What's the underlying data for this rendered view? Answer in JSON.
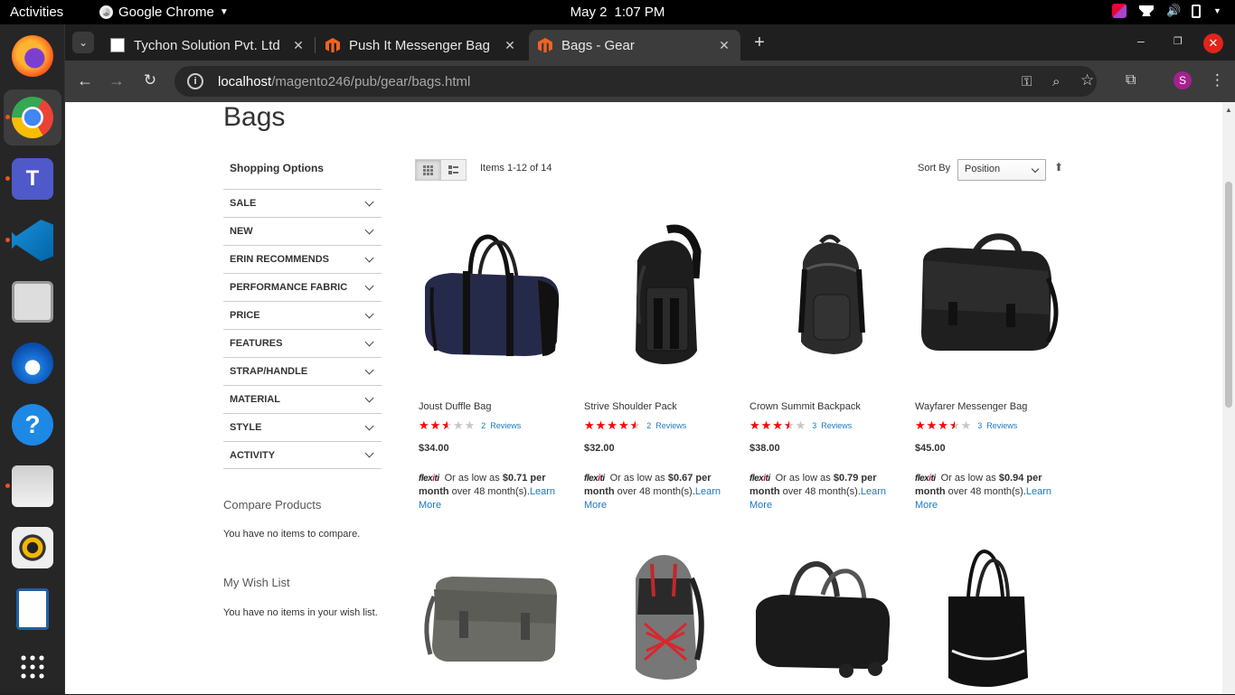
{
  "os": {
    "activities": "Activities",
    "app_name": "Google Chrome",
    "date": "May 2",
    "time": "1:07 PM"
  },
  "browser": {
    "tabs": [
      {
        "title": "Tychon Solution Pvt. Ltd",
        "active": false
      },
      {
        "title": "Push It Messenger Bag",
        "active": false
      },
      {
        "title": "Bags - Gear",
        "active": true
      }
    ],
    "url_host": "localhost",
    "url_path": "/magento246/pub/gear/bags.html",
    "profile_initial": "S"
  },
  "page": {
    "title": "Bags",
    "shopping_options": "Shopping Options",
    "filters": [
      "SALE",
      "NEW",
      "ERIN RECOMMENDS",
      "PERFORMANCE FABRIC",
      "PRICE",
      "FEATURES",
      "STRAP/HANDLE",
      "MATERIAL",
      "STYLE",
      "ACTIVITY"
    ],
    "compare_title": "Compare Products",
    "compare_text": "You have no items to compare.",
    "wishlist_title": "My Wish List",
    "wishlist_text": "You have no items in your wish list.",
    "toolbar": {
      "amount": "Items 1-12 of 14",
      "sort_label": "Sort By",
      "sort_value": "Position"
    },
    "products": [
      {
        "name": "Joust Duffle Bag",
        "rating": 0.5,
        "review_count": "2",
        "review_label": "Reviews",
        "price": "$34.00",
        "flexiti_amount": "$0.71 per",
        "flexiti_month": "month",
        "flexiti_term": "over 48 month(s).",
        "learn_1": "Learn",
        "learn_2": "More"
      },
      {
        "name": "Strive Shoulder Pack",
        "rating": 0.9,
        "review_count": "2",
        "review_label": "Reviews",
        "price": "$32.00",
        "flexiti_amount": "$0.67 per",
        "flexiti_month": "month",
        "flexiti_term": "over 48 month(s).",
        "learn_1": "Learn",
        "learn_2": "More"
      },
      {
        "name": "Crown Summit Backpack",
        "rating": 0.7,
        "review_count": "3",
        "review_label": "Reviews",
        "price": "$38.00",
        "flexiti_amount": "$0.79 per",
        "flexiti_month": "month",
        "flexiti_term": "over 48 month(s).",
        "learn_1": "Learn",
        "learn_2": "More"
      },
      {
        "name": "Wayfarer Messenger Bag",
        "rating": 0.7,
        "review_count": "3",
        "review_label": "Reviews",
        "price": "$45.00",
        "flexiti_amount": "$0.94 per",
        "flexiti_month": "month",
        "flexiti_term": "over 48 month(s).",
        "learn_1": "Learn",
        "learn_2": "More"
      }
    ],
    "flexiti_prefix": "Or as low as",
    "flexiti_logo": "flexiti"
  },
  "colors": {
    "star_fill": "#ff0000",
    "link": "#1979c3",
    "ubuntu_accent": "#e95420"
  }
}
